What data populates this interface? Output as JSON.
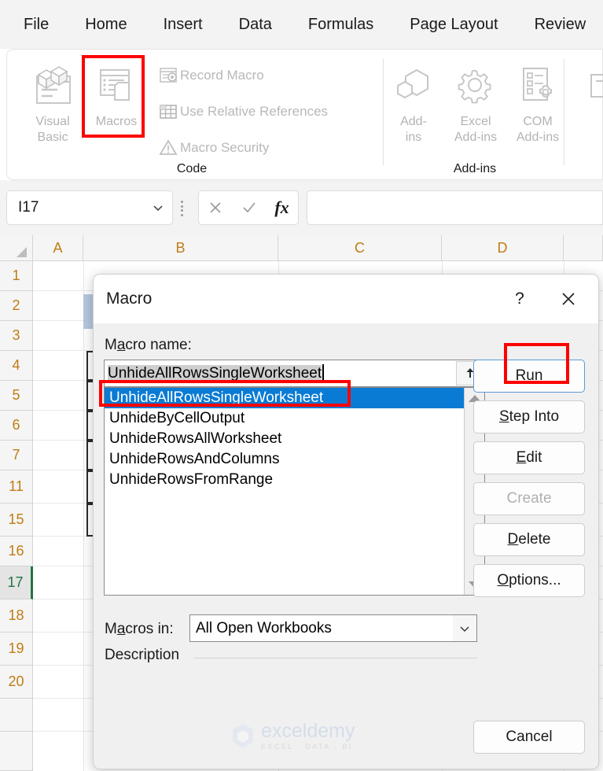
{
  "ribbon": {
    "tabs": [
      {
        "label": "File"
      },
      {
        "label": "Home"
      },
      {
        "label": "Insert"
      },
      {
        "label": "Data"
      },
      {
        "label": "Formulas"
      },
      {
        "label": "Page Layout"
      },
      {
        "label": "Review"
      }
    ],
    "groups": [
      {
        "name": "Code",
        "label": "Code"
      },
      {
        "name": "Add-ins",
        "label": "Add-ins"
      }
    ],
    "code_group": {
      "big_buttons": [
        {
          "label_line1": "Visual",
          "label_line2": "Basic",
          "icon": "visual-basic-icon"
        },
        {
          "label_line1": "Macros",
          "label_line2": "",
          "icon": "macros-icon"
        }
      ],
      "small_items": [
        {
          "label": "Record Macro",
          "icon": "record-macro-icon"
        },
        {
          "label": "Use Relative References",
          "icon": "relative-references-icon"
        },
        {
          "label": "Macro Security",
          "icon": "macro-security-icon"
        }
      ]
    },
    "addins_group": {
      "buttons": [
        {
          "label_line1": "Add-",
          "label_line2": "ins",
          "icon": "addins-icon"
        },
        {
          "label_line1": "Excel",
          "label_line2": "Add-ins",
          "icon": "excel-addins-icon"
        },
        {
          "label_line1": "COM",
          "label_line2": "Add-ins",
          "icon": "com-addins-icon"
        }
      ]
    }
  },
  "formula_bar": {
    "name_box_value": "I17",
    "name_box_chevron": "chevron-down-icon",
    "cancel_icon": "cancel-x-icon",
    "confirm_icon": "confirm-check-icon",
    "function_icon": "fx-icon",
    "formula_value": ""
  },
  "sheet": {
    "columns": [
      "A",
      "B",
      "C",
      "D"
    ],
    "rows": [
      "1",
      "2",
      "3",
      "4",
      "5",
      "6",
      "7",
      "11",
      "15",
      "16",
      "17",
      "18",
      "19",
      "20"
    ],
    "selected_row": "17"
  },
  "dialog": {
    "title": "Macro",
    "help_label": "?",
    "close_icon": "close-x-icon",
    "macro_name_label_pre": "M",
    "macro_name_label_accel": "a",
    "macro_name_label_post": "cro name:",
    "macro_name_value": "UnhideAllRowsSingleWorksheet",
    "upload_icon": "upload-arrow-icon",
    "macro_list": [
      "UnhideAllRowsSingleWorksheet",
      "UnhideByCellOutput",
      "UnhideRowsAllWorksheet",
      "UnhideRowsAndColumns",
      "UnhideRowsFromRange"
    ],
    "selected_macro": "UnhideAllRowsSingleWorksheet",
    "scroll_up_icon": "scroll-up-arrow-icon",
    "scroll_down_icon": "scroll-down-arrow-icon",
    "buttons": [
      {
        "label": "Run",
        "accel": "R",
        "rest": "un",
        "state": "default",
        "highlighted": true
      },
      {
        "label": "Step Into",
        "accel": "S",
        "rest": "tep Into",
        "state": "default",
        "highlighted": false
      },
      {
        "label": "Edit",
        "accel": "E",
        "rest": "dit",
        "state": "default",
        "highlighted": false
      },
      {
        "label": "Create",
        "accel": "",
        "rest": "Create",
        "state": "disabled",
        "highlighted": false
      },
      {
        "label": "Delete",
        "accel": "D",
        "rest": "elete",
        "state": "default",
        "highlighted": false
      },
      {
        "label": "Options...",
        "accel": "O",
        "rest": "ptions...",
        "state": "default",
        "highlighted": false
      }
    ],
    "macros_in_label_pre": "M",
    "macros_in_label_accel": "a",
    "macros_in_label_post": "cros in:",
    "macros_in_value": "All Open Workbooks",
    "macros_in_chevron": "chevron-down-icon",
    "description_label": "Description",
    "description_value": "",
    "cancel_label": "Cancel"
  },
  "watermark": {
    "brand": "exceldemy",
    "tagline": "EXCEL · DATA · BI",
    "logo": "exceldemy-cube-logo"
  },
  "colors": {
    "accent_blue": "#0a7bd4",
    "highlight_red": "#ff0000",
    "excel_green": "#217346",
    "column_header_text": "#c07c14",
    "ribbon_bg": "#f3f3f3",
    "dialog_bg": "#f0f0f0"
  }
}
